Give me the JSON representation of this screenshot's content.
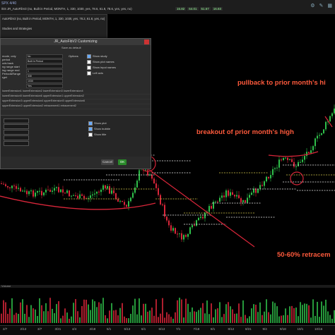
{
  "topbar": {
    "title": "SPX 4/40",
    "quote_line": "/ES  JR_AutoFibV2 (no, Built in Period, MONTH, 1, 330, 1030, yes, 78.6, 61.8, 78.6, yes, yes, no)",
    "cells": [
      "15.82",
      "",
      "",
      "64.01",
      "",
      "51.67",
      "",
      "16.83",
      "",
      "",
      "",
      "",
      ""
    ]
  },
  "studies_panel": {
    "line1": "AutoFibV2 (no, Built in Period, MONTH, 1, 330, 1030, yes, 78.2, 61.8, yes, no)",
    "line2": "Studies and Strategies"
  },
  "dialog": {
    "title": "JR_AutoFibV2 Customizing",
    "save_label": "Save as default",
    "inputs_labels": [
      "mode, only",
      "period",
      "ods back",
      "ng range start",
      "ing range end",
      "Period&Range",
      "rget"
    ],
    "input_values": [
      "No",
      "Built In Period",
      "",
      "1",
      "330",
      "1030",
      "Yes"
    ],
    "options_label": "Options",
    "options": [
      {
        "label": "Show study",
        "checked": true
      },
      {
        "label": "Show plot names",
        "checked": false
      },
      {
        "label": "Show input names",
        "checked": false
      },
      {
        "label": "Left axis",
        "checked": false
      }
    ],
    "plots_rows": [
      "lowerExtension1   lowerExtension2   lowerExtension3   lowerExtension4",
      "lowerExtension5   lowerExtension6   upperExtension1   upperExtension2",
      "upperExtension3   upperExtension4   upperExtension5   upperExtension6",
      "upperExtension2   upperExtension2   retracement1   retracement2"
    ],
    "lower_options": [
      {
        "label": "Show plot",
        "checked": true
      },
      {
        "label": "Show bubble",
        "checked": true
      },
      {
        "label": "Show title",
        "checked": false
      }
    ],
    "cancel_label": "Cancel",
    "ok_label": "OK"
  },
  "annotations": {
    "pullback": "pullback to prior month's hi",
    "breakout": "breakout of prior month's high",
    "retracement": "50-60% retracem"
  },
  "volume_label": "Volume",
  "x_axis": [
    "2/7",
    "2/13",
    "3/7",
    "3/21",
    "4/4",
    "4/18",
    "5/1",
    "5/13",
    "6/1",
    "6/13",
    "7/1",
    "7/18",
    "8/1",
    "8/12",
    "8/21",
    "9/4",
    "9/18",
    "10/1",
    "10/16"
  ],
  "colors": {
    "annotation": "#ff5a3c",
    "bull": "#2fbf4a",
    "bear": "#d9263a",
    "fib_yellow": "#d6c84b",
    "bg": "#000000"
  }
}
